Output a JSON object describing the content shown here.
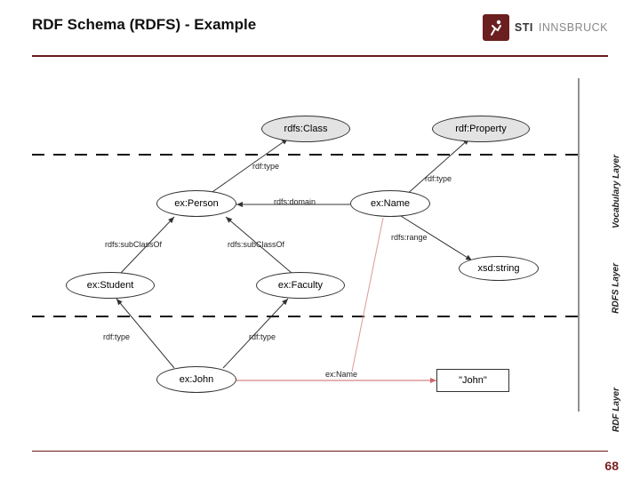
{
  "header": {
    "title": "RDF Schema (RDFS) - Example",
    "logo_a": "STI",
    "logo_b": "INNSBRUCK"
  },
  "page_number": "68",
  "layers": {
    "vocab": "Vocabulary Layer",
    "rdfs": "RDFS Layer",
    "rdf": "RDF Layer"
  },
  "nodes": {
    "rdfsClass": "rdfs:Class",
    "rdfProperty": "rdf:Property",
    "exPerson": "ex:Person",
    "exName": "ex:Name",
    "exStudent": "ex:Student",
    "exFaculty": "ex:Faculty",
    "xsdString": "xsd:string",
    "exJohn": "ex:John",
    "johnLit": "\"John\""
  },
  "edges": {
    "rdfType": "rdf:type",
    "rdfsDomain": "rdfs:domain",
    "rdfsRange": "rdfs:range",
    "subClassOf": "rdfs:subClassOf",
    "exNameEdge": "ex:Name"
  }
}
